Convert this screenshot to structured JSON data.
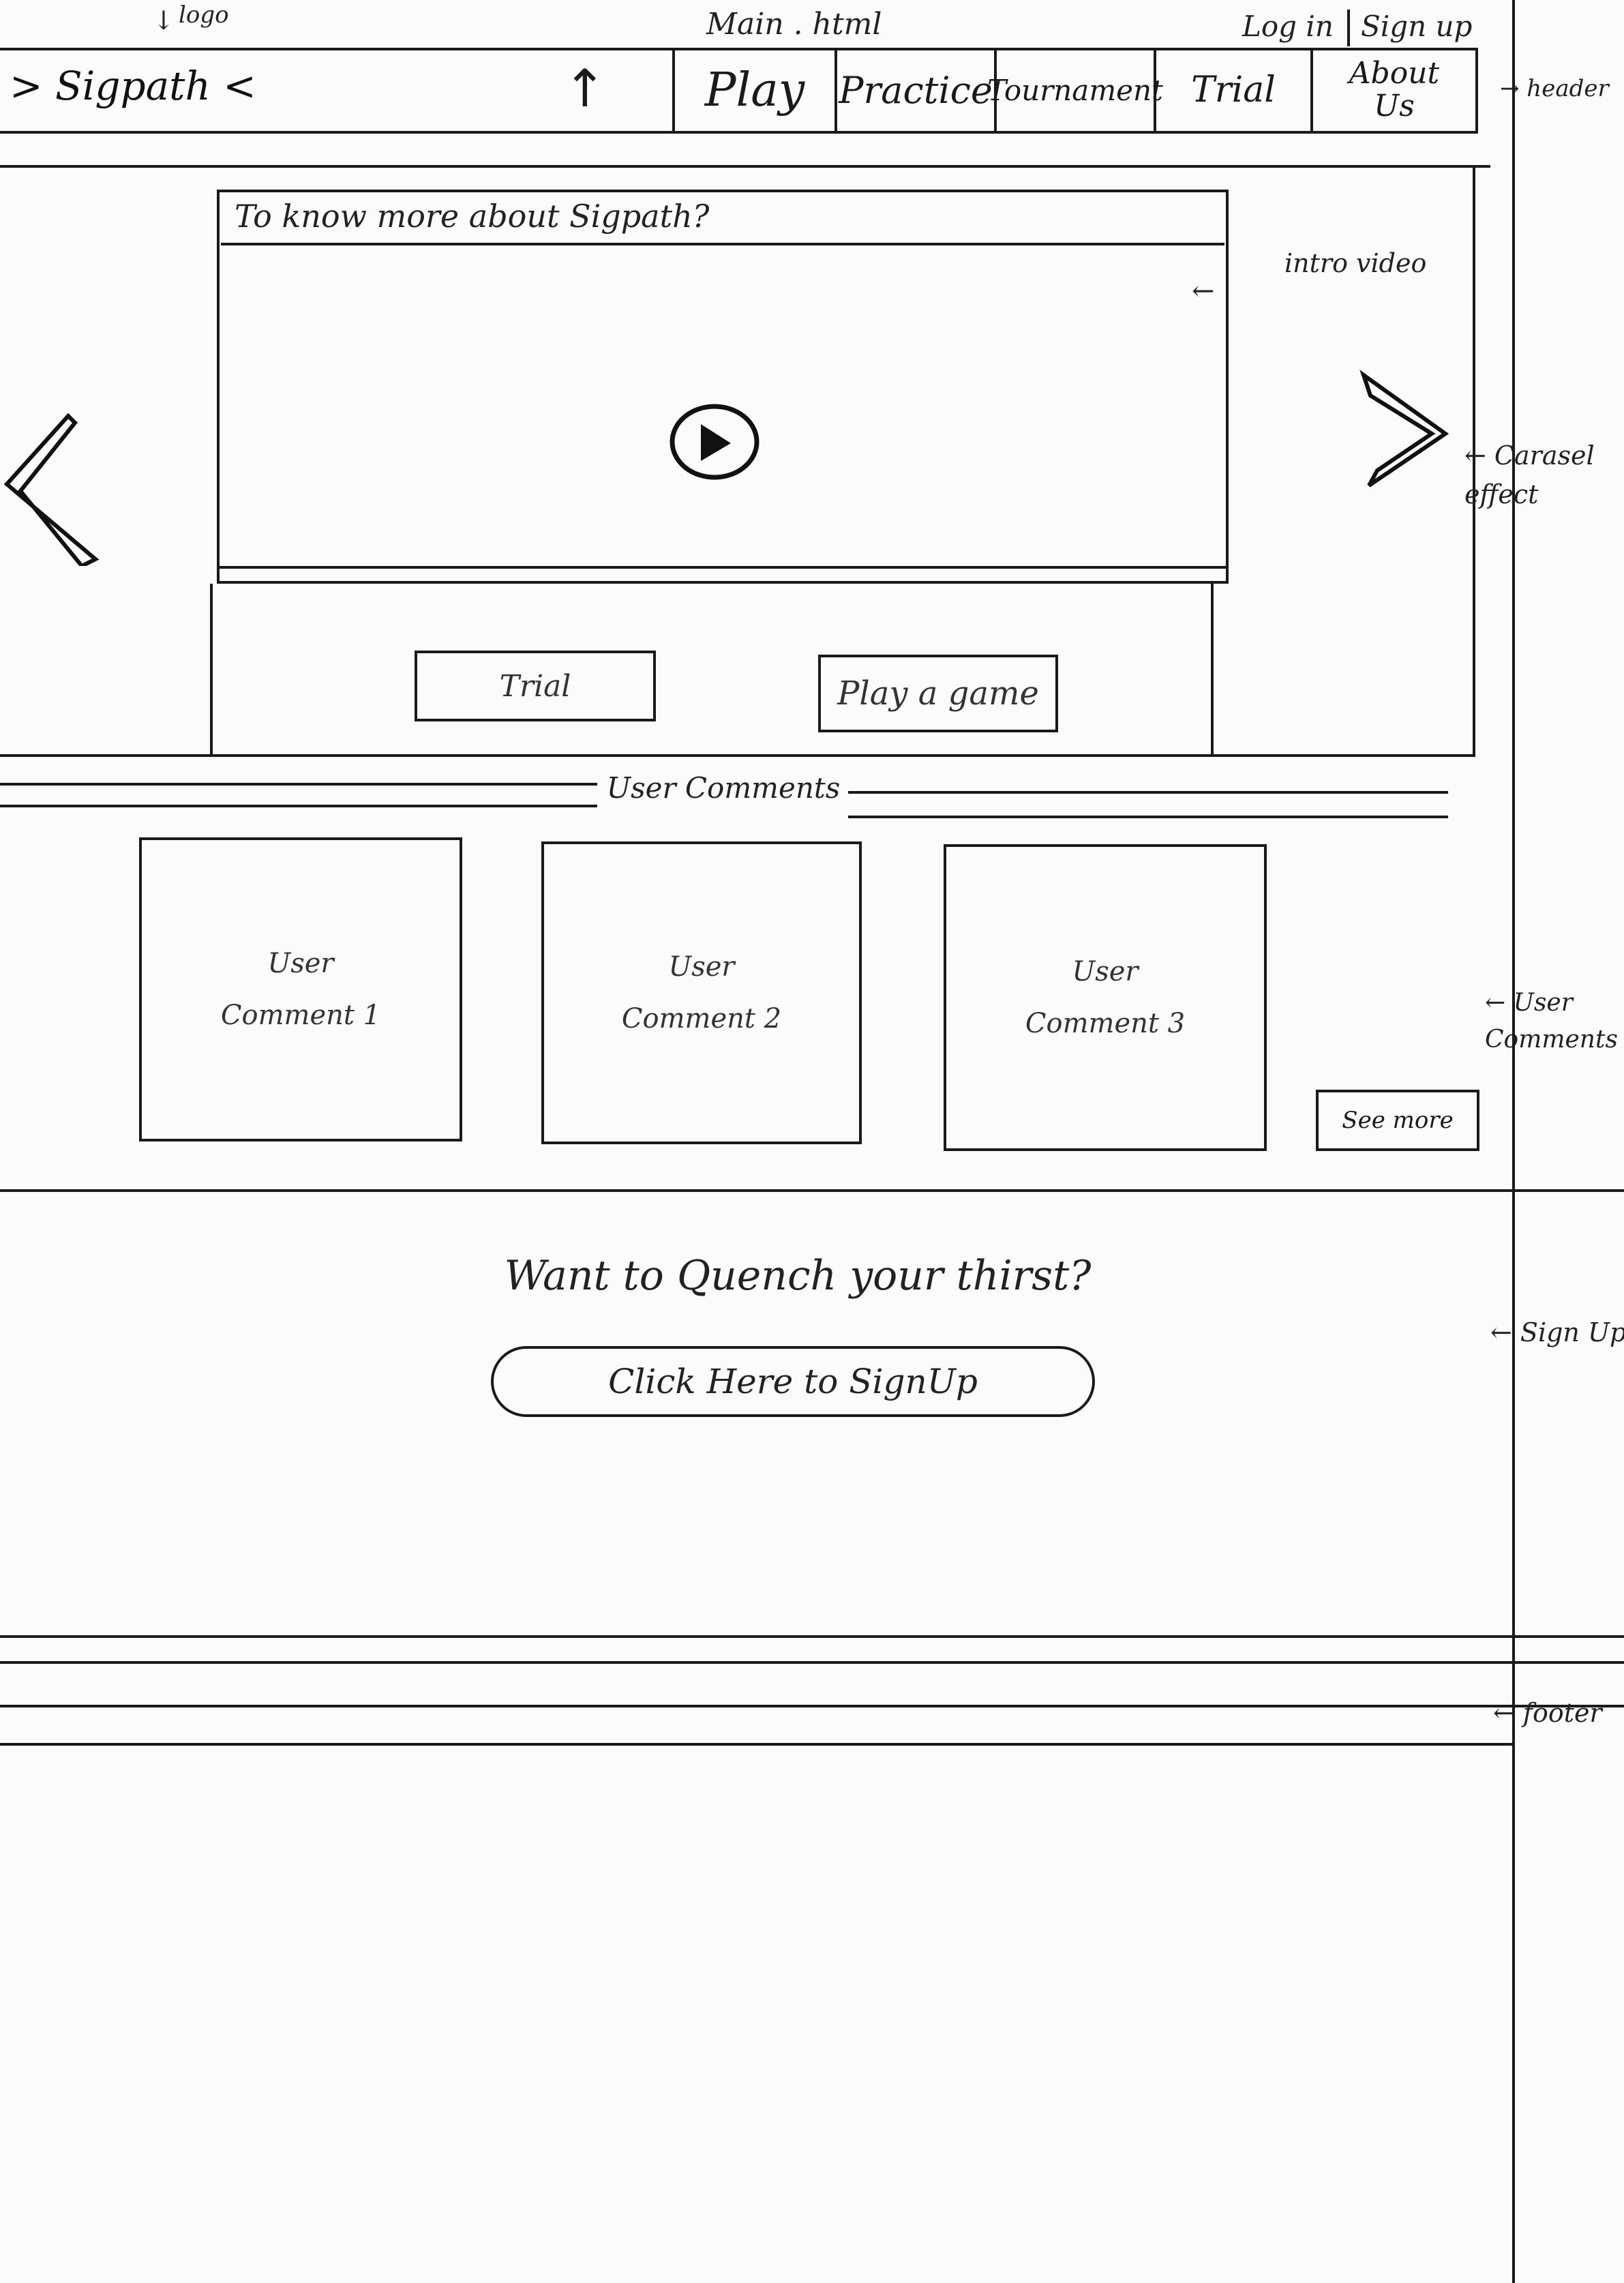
{
  "meta": {
    "logo_note": "logo",
    "file_name": "Main . html"
  },
  "header": {
    "login": "Log in",
    "signup": "Sign up",
    "logo_text": "> Sigpath <",
    "nav": [
      {
        "label": "Play"
      },
      {
        "label": "Practice"
      },
      {
        "label": "Tournament"
      },
      {
        "label": "Trial"
      },
      {
        "label": "About Us"
      }
    ]
  },
  "carousel": {
    "video_title": "To know more about Sigpath?",
    "trial_button": "Trial",
    "play_button": "Play a game"
  },
  "comments": {
    "title": "User Comments",
    "items": [
      {
        "line1": "User",
        "line2": "Comment 1"
      },
      {
        "line1": "User",
        "line2": "Comment 2"
      },
      {
        "line1": "User",
        "line2": "Comment 3"
      }
    ],
    "see_more": "See more"
  },
  "signup_section": {
    "heading": "Want to Quench your thirst?",
    "button": "Click Here to SignUp"
  },
  "annotations": {
    "header": "header",
    "intro_video": "intro video",
    "carousel_effect": "Carasel effect",
    "user_comments": "User Comments",
    "signup": "Sign Up",
    "footer": "footer"
  }
}
